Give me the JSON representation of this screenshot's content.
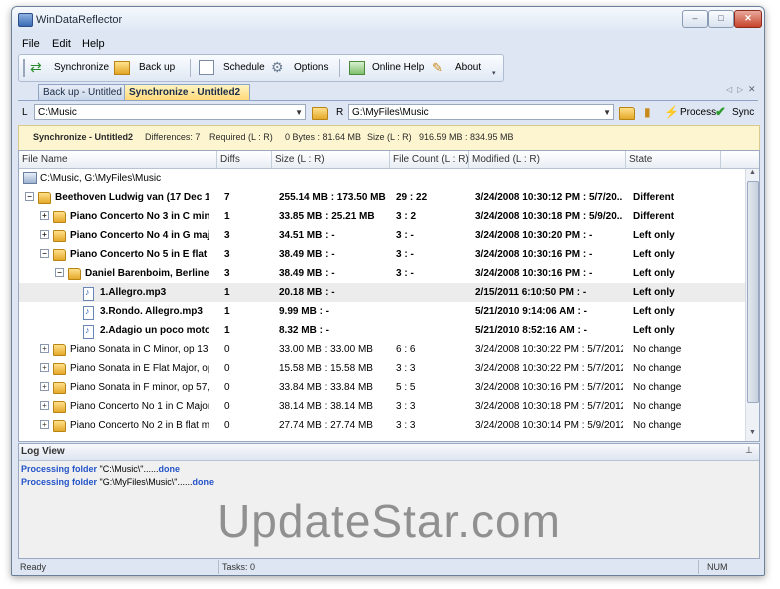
{
  "window": {
    "title": "WinDataReflector"
  },
  "menu": [
    "File",
    "Edit",
    "Help"
  ],
  "toolbar": {
    "synchronize": "Synchronize",
    "backup": "Back up",
    "schedule": "Schedule",
    "options": "Options",
    "online_help": "Online Help",
    "about": "About"
  },
  "tabs": [
    {
      "label": "Back up - Untitled",
      "active": false
    },
    {
      "label": "Synchronize - Untitled2",
      "active": true
    }
  ],
  "paths": {
    "left_label": "L",
    "left": "C:\\Music",
    "right_label": "R",
    "right": "G:\\MyFiles\\Music",
    "process": "Process",
    "sync": "Sync"
  },
  "info": {
    "name": "Synchronize - Untitled2",
    "differences": "Differences: 7",
    "required": "Required (L : R)",
    "required_value": "0 Bytes : 81.64 MB",
    "size": "Size (L : R)",
    "size_value": "916.59 MB : 834.95 MB"
  },
  "columns": [
    "File Name",
    "Diffs",
    "Size (L : R)",
    "File Count (L : R)",
    "Modified (L : R)",
    "State"
  ],
  "root_path": "C:\\Music, G:\\MyFiles\\Music",
  "rows": [
    {
      "name": "Beethoven Ludwig van (17 Dec 17...",
      "diffs": "7",
      "size": "255.14 MB : 173.50 MB",
      "count": "29 : 22",
      "modified": "3/24/2008 10:30:12 PM : 5/7/20...",
      "state": "Different",
      "bold": true
    },
    {
      "name": "Piano Concerto No 3 in C minor...",
      "diffs": "1",
      "size": "33.85 MB : 25.21 MB",
      "count": "3 : 2",
      "modified": "3/24/2008 10:30:18 PM : 5/9/20...",
      "state": "Different",
      "bold": true
    },
    {
      "name": "Piano Concerto No 4 in G major...",
      "diffs": "3",
      "size": "34.51 MB : -",
      "count": "3 : -",
      "modified": "3/24/2008 10:30:20 PM : -",
      "state": "Left only",
      "bold": true
    },
    {
      "name": "Piano Concerto No 5 in E flat m...",
      "diffs": "3",
      "size": "38.49 MB : -",
      "count": "3 : -",
      "modified": "3/24/2008 10:30:16 PM : -",
      "state": "Left only",
      "bold": true
    },
    {
      "name": "Daniel Barenboim, Berliner ...",
      "diffs": "3",
      "size": "38.49 MB : -",
      "count": "3 : -",
      "modified": "3/24/2008 10:30:16 PM : -",
      "state": "Left only",
      "bold": true
    },
    {
      "name": "1.Allegro.mp3",
      "diffs": "1",
      "size": "20.18 MB : -",
      "count": "",
      "modified": "2/15/2011 6:10:50 PM : -",
      "state": "Left only",
      "bold": true
    },
    {
      "name": "3.Rondo. Allegro.mp3",
      "diffs": "1",
      "size": "9.99 MB : -",
      "count": "",
      "modified": "5/21/2010 9:14:06 AM : -",
      "state": "Left only",
      "bold": true
    },
    {
      "name": "2.Adagio un poco moto....",
      "diffs": "1",
      "size": "8.32 MB : -",
      "count": "",
      "modified": "5/21/2010 8:52:16 AM : -",
      "state": "Left only",
      "bold": true
    },
    {
      "name": "Piano Sonata in C Minor, op 13",
      "diffs": "0",
      "size": "33.00 MB : 33.00 MB",
      "count": "6 : 6",
      "modified": "3/24/2008 10:30:22 PM : 5/7/2012 ...",
      "state": "No change",
      "bold": false
    },
    {
      "name": "Piano Sonata in E Flat Major, op ...",
      "diffs": "0",
      "size": "15.58 MB : 15.58 MB",
      "count": "3 : 3",
      "modified": "3/24/2008 10:30:22 PM : 5/7/2012 ...",
      "state": "No change",
      "bold": false
    },
    {
      "name": "Piano Sonata in F minor, op 57, ...",
      "diffs": "0",
      "size": "33.84 MB : 33.84 MB",
      "count": "5 : 5",
      "modified": "3/24/2008 10:30:16 PM : 5/7/2012 ...",
      "state": "No change",
      "bold": false
    },
    {
      "name": "Piano Concerto No 1 in C Major,...",
      "diffs": "0",
      "size": "38.14 MB : 38.14 MB",
      "count": "3 : 3",
      "modified": "3/24/2008 10:30:18 PM : 5/7/2012 ...",
      "state": "No change",
      "bold": false
    },
    {
      "name": "Piano Concerto No 2 in B flat ma...",
      "diffs": "0",
      "size": "27.74 MB : 27.74 MB",
      "count": "3 : 3",
      "modified": "3/24/2008 10:30:14 PM : 5/9/2012 ...",
      "state": "No change",
      "bold": false
    }
  ],
  "log": {
    "title": "Log View",
    "lines": [
      {
        "prefix": "Processing folder",
        "path": "\"C:\\Music\\\"......",
        "suffix": "done"
      },
      {
        "prefix": "Processing folder",
        "path": "\"G:\\MyFiles\\Music\\\"......",
        "suffix": "done"
      }
    ]
  },
  "watermark": "UpdateStar.com",
  "status": {
    "ready": "Ready",
    "tasks": "Tasks: 0",
    "num": "NUM"
  }
}
